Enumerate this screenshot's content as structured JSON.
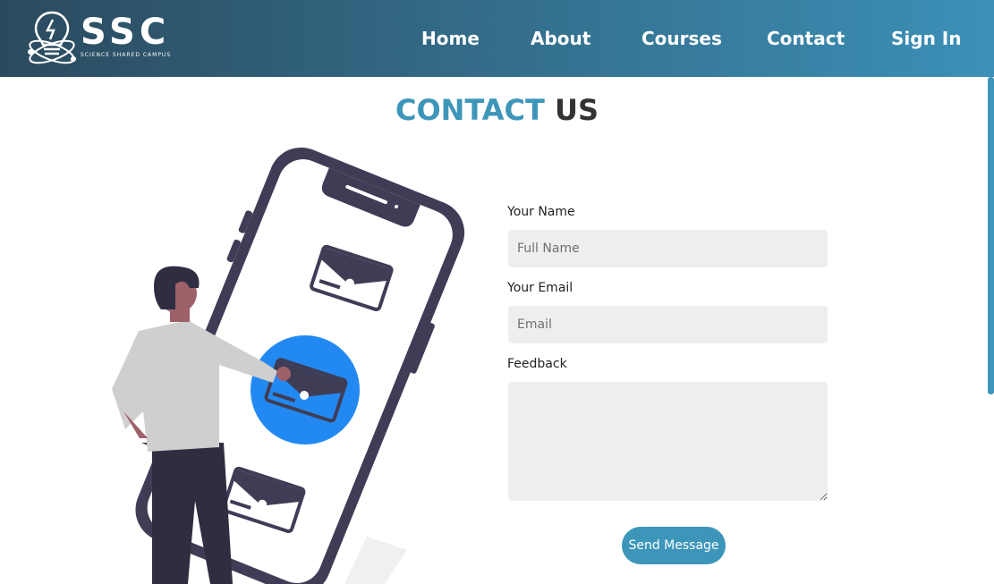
{
  "brand": {
    "name": "SSC",
    "tagline": "SCIENCE SHARED CAMPUS",
    "logo_icon": "lightbulb-atom-icon"
  },
  "nav": {
    "items": [
      {
        "label": "Home"
      },
      {
        "label": "About"
      },
      {
        "label": "Courses"
      },
      {
        "label": "Contact"
      },
      {
        "label": "Sign In"
      }
    ]
  },
  "heading": {
    "accent": "CONTACT",
    "rest": "US"
  },
  "form": {
    "name_label": "Your Name",
    "name_placeholder": "Full Name",
    "email_label": "Your Email",
    "email_placeholder": "Email",
    "feedback_label": "Feedback",
    "submit_label": "Send Message"
  },
  "colors": {
    "accent": "#3d96b9",
    "nav_start": "#2b4a5e",
    "nav_end": "#3c90b8",
    "highlight_circle": "#2389f2",
    "dark_ink": "#3f3d56"
  },
  "illustration": {
    "icon": "person-phone-mail-illustration"
  }
}
